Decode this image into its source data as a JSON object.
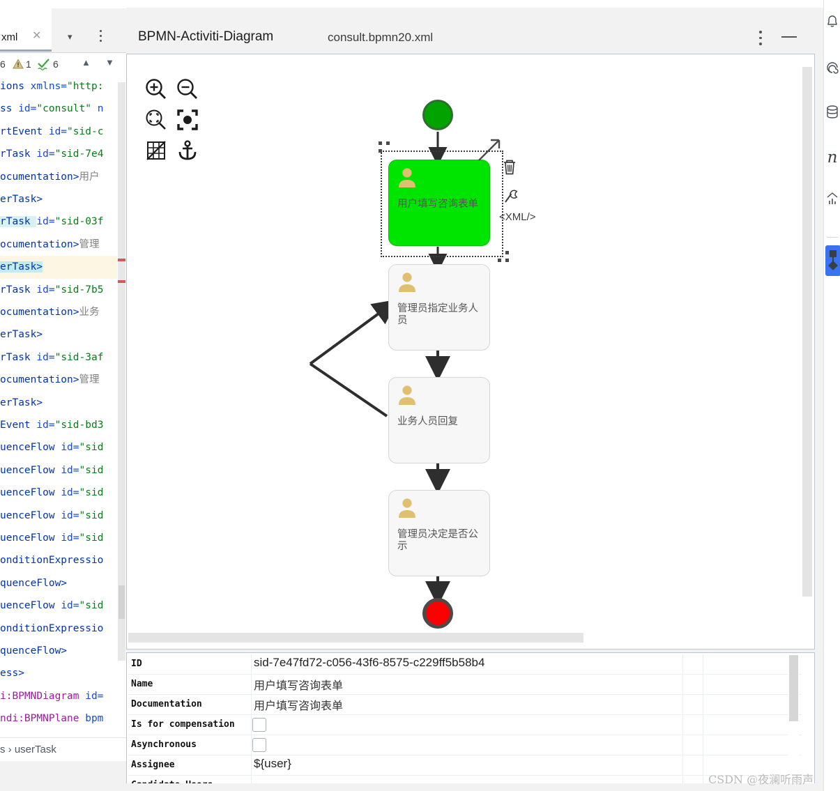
{
  "editor": {
    "tab_label": "xml",
    "close_icon": "close-icon",
    "chevron_icon": "chevron-down-icon",
    "kebab_icon": "more-vertical-icon",
    "inspections": {
      "error_count": "6",
      "warning_count": "1",
      "ok_count": "6",
      "prev_icon": "chevron-up-icon",
      "next_icon": "chevron-down-icon"
    },
    "breadcrumb": "s › userTask",
    "code_lines": [
      {
        "segments": [
          {
            "t": "ions ",
            "c": "t-tag"
          },
          {
            "t": "xmlns=",
            "c": "t-attr"
          },
          {
            "t": "\"http:",
            "c": "t-val"
          }
        ]
      },
      {
        "segments": [
          {
            "t": "ss ",
            "c": "t-tag"
          },
          {
            "t": "id=",
            "c": "t-attr"
          },
          {
            "t": "\"consult\"",
            "c": "t-val"
          },
          {
            "t": " n",
            "c": "t-attr"
          }
        ]
      },
      {
        "segments": [
          {
            "t": "rtEvent ",
            "c": "t-tag"
          },
          {
            "t": "id=",
            "c": "t-attr"
          },
          {
            "t": "\"sid-c",
            "c": "t-val"
          }
        ]
      },
      {
        "segments": [
          {
            "t": "rTask ",
            "c": "t-tag"
          },
          {
            "t": "id=",
            "c": "t-attr"
          },
          {
            "t": "\"sid-7e4",
            "c": "t-val"
          }
        ]
      },
      {
        "segments": [
          {
            "t": "ocumentation>",
            "c": "t-tag"
          },
          {
            "t": "用户",
            "c": "t-text"
          }
        ]
      },
      {
        "segments": [
          {
            "t": "erTask>",
            "c": "t-tag"
          }
        ]
      },
      {
        "segments": [
          {
            "t": "rTask ",
            "c": "t-tag hl-soft"
          },
          {
            "t": "id=",
            "c": "t-attr"
          },
          {
            "t": "\"sid-03f",
            "c": "t-val"
          }
        ]
      },
      {
        "segments": [
          {
            "t": "ocumentation>",
            "c": "t-tag"
          },
          {
            "t": "管理",
            "c": "t-text"
          }
        ]
      },
      {
        "segments": [
          {
            "t": "erTask>",
            "c": "t-tag hl-sel"
          }
        ]
      },
      {
        "segments": [
          {
            "t": "rTask ",
            "c": "t-tag"
          },
          {
            "t": "id=",
            "c": "t-attr"
          },
          {
            "t": "\"sid-7b5",
            "c": "t-val"
          }
        ]
      },
      {
        "segments": [
          {
            "t": "ocumentation>",
            "c": "t-tag"
          },
          {
            "t": "业务",
            "c": "t-text"
          }
        ]
      },
      {
        "segments": [
          {
            "t": "erTask>",
            "c": "t-tag"
          }
        ]
      },
      {
        "segments": [
          {
            "t": "rTask ",
            "c": "t-tag"
          },
          {
            "t": "id=",
            "c": "t-attr"
          },
          {
            "t": "\"sid-3af",
            "c": "t-val"
          }
        ]
      },
      {
        "segments": [
          {
            "t": "ocumentation>",
            "c": "t-tag"
          },
          {
            "t": "管理",
            "c": "t-text"
          }
        ]
      },
      {
        "segments": [
          {
            "t": "erTask>",
            "c": "t-tag"
          }
        ]
      },
      {
        "segments": [
          {
            "t": "Event ",
            "c": "t-tag"
          },
          {
            "t": "id=",
            "c": "t-attr"
          },
          {
            "t": "\"sid-bd3",
            "c": "t-val"
          }
        ]
      },
      {
        "segments": [
          {
            "t": "uenceFlow ",
            "c": "t-tag"
          },
          {
            "t": "id=",
            "c": "t-attr"
          },
          {
            "t": "\"sid",
            "c": "t-val"
          }
        ]
      },
      {
        "segments": [
          {
            "t": "uenceFlow ",
            "c": "t-tag"
          },
          {
            "t": "id=",
            "c": "t-attr"
          },
          {
            "t": "\"sid",
            "c": "t-val"
          }
        ]
      },
      {
        "segments": [
          {
            "t": "uenceFlow ",
            "c": "t-tag"
          },
          {
            "t": "id=",
            "c": "t-attr"
          },
          {
            "t": "\"sid",
            "c": "t-val"
          }
        ]
      },
      {
        "segments": [
          {
            "t": "uenceFlow ",
            "c": "t-tag"
          },
          {
            "t": "id=",
            "c": "t-attr"
          },
          {
            "t": "\"sid",
            "c": "t-val"
          }
        ]
      },
      {
        "segments": [
          {
            "t": "uenceFlow ",
            "c": "t-tag"
          },
          {
            "t": "id=",
            "c": "t-attr"
          },
          {
            "t": "\"sid",
            "c": "t-val"
          }
        ]
      },
      {
        "segments": [
          {
            "t": "onditionExpressio",
            "c": "t-tag"
          }
        ]
      },
      {
        "segments": [
          {
            "t": "quenceFlow>",
            "c": "t-tag"
          }
        ]
      },
      {
        "segments": [
          {
            "t": "uenceFlow ",
            "c": "t-tag"
          },
          {
            "t": "id=",
            "c": "t-attr"
          },
          {
            "t": "\"sid",
            "c": "t-val"
          }
        ]
      },
      {
        "segments": [
          {
            "t": "onditionExpressio",
            "c": "t-tag"
          }
        ]
      },
      {
        "segments": [
          {
            "t": "quenceFlow>",
            "c": "t-tag"
          }
        ]
      },
      {
        "segments": [
          {
            "t": "ess>",
            "c": "t-tag"
          }
        ]
      },
      {
        "segments": [
          {
            "t": "i:BPMNDiagram ",
            "c": "t-pink"
          },
          {
            "t": "id=",
            "c": "t-attr"
          },
          {
            "t": "",
            "c": "t-val"
          }
        ]
      },
      {
        "segments": [
          {
            "t": "ndi:BPMNPlane ",
            "c": "t-pink"
          },
          {
            "t": "bpm",
            "c": "t-attr"
          }
        ]
      }
    ]
  },
  "main": {
    "title": "BPMN-Activiti-Diagram",
    "file_tab": "consult.bpmn20.xml",
    "kebab_icon": "more-vertical-icon",
    "minimize_icon": "minimize-icon"
  },
  "canvas_toolbar": [
    {
      "name": "zoom-in-icon",
      "label": "Zoom In"
    },
    {
      "name": "zoom-out-icon",
      "label": "Zoom Out"
    },
    {
      "name": "zoom-fit-icon",
      "label": "Zoom to Fit"
    },
    {
      "name": "zoom-actual-icon",
      "label": "Actual Size"
    },
    {
      "name": "grid-off-icon",
      "label": "Toggle Grid"
    },
    {
      "name": "anchor-icon",
      "label": "Toggle Snap"
    }
  ],
  "diagram": {
    "start_event": {
      "name": "start-event",
      "type": "startEvent"
    },
    "end_event": {
      "name": "end-event",
      "type": "endEvent"
    },
    "tasks": [
      {
        "label": "用户填写咨询表单",
        "selected": true
      },
      {
        "label": "管理员指定业务人员",
        "selected": false
      },
      {
        "label": "业务人员回复",
        "selected": false
      },
      {
        "label": "管理员决定是否公示",
        "selected": false
      }
    ],
    "selection_actions": [
      {
        "name": "connect-arrow-icon",
        "glyph": "↗"
      },
      {
        "name": "delete-icon",
        "glyph": "🗑"
      },
      {
        "name": "wrench-icon",
        "glyph": "🔧"
      },
      {
        "name": "xml-label",
        "glyph": "<XML/>"
      }
    ]
  },
  "properties": {
    "rows": [
      {
        "key": "ID",
        "value": "sid-7e47fd72-c056-43f6-8575-c229ff5b58b4",
        "type": "text"
      },
      {
        "key": "Name",
        "value": "用户填写咨询表单",
        "type": "serif"
      },
      {
        "key": "Documentation",
        "value": "用户填写咨询表单",
        "type": "serif"
      },
      {
        "key": "Is for compensation",
        "value": "",
        "type": "checkbox"
      },
      {
        "key": "Asynchronous",
        "value": "",
        "type": "checkbox"
      },
      {
        "key": "Assignee",
        "value": "${user}",
        "type": "text"
      },
      {
        "key": "Candidate Users",
        "value": "",
        "type": "text"
      }
    ]
  },
  "right_sidebar": [
    {
      "name": "notifications-bell-icon",
      "glyph": "🔔"
    },
    {
      "name": "coffee-spiral-icon",
      "glyph": "◎"
    },
    {
      "name": "database-icon",
      "glyph": "🗄"
    },
    {
      "name": "maven-n-icon",
      "glyph": "n"
    },
    {
      "name": "chart-up-icon",
      "glyph": "📈"
    },
    {
      "name": "download-import-icon",
      "glyph": "⬇"
    }
  ],
  "watermark": "CSDN @夜澜听雨声"
}
